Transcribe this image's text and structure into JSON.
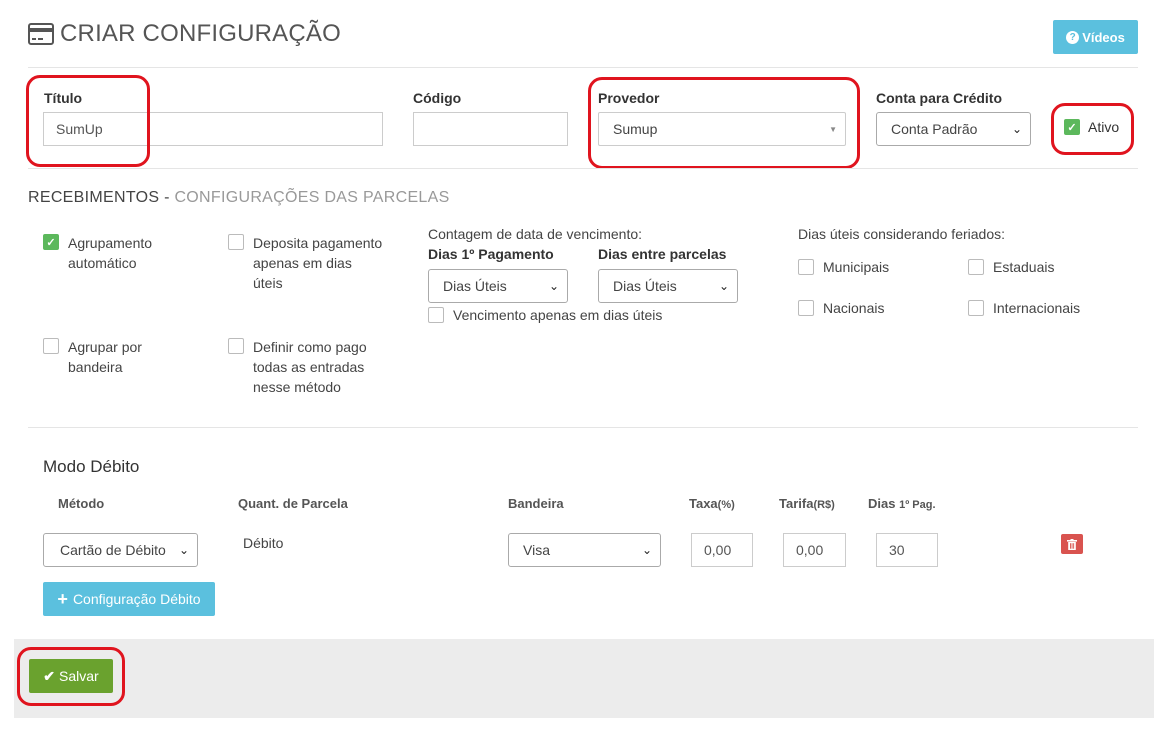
{
  "header": {
    "title": "CRIAR CONFIGURAÇÃO",
    "videos_label": "Vídeos"
  },
  "form": {
    "titulo": {
      "label": "Título",
      "value": "SumUp"
    },
    "codigo": {
      "label": "Código",
      "value": ""
    },
    "provedor": {
      "label": "Provedor",
      "value": "Sumup"
    },
    "conta": {
      "label": "Conta para Crédito",
      "value": "Conta Padrão"
    },
    "ativo": {
      "label": "Ativo",
      "checked": true
    }
  },
  "recebimentos": {
    "title": "RECEBIMENTOS",
    "separator": " - ",
    "subtitle": "CONFIGURAÇÕES DAS PARCELAS",
    "options": {
      "agrupamento": {
        "label_1": "Agrupamento",
        "label_2": "automático",
        "checked": true
      },
      "deposita": {
        "label_1": "Deposita pagamento",
        "label_2": "apenas em dias",
        "label_3": "úteis",
        "checked": false
      },
      "agrupar_bandeira": {
        "label_1": "Agrupar por",
        "label_2": "bandeira",
        "checked": false
      },
      "definir_pago": {
        "label_1": "Definir como pago",
        "label_2": "todas as entradas",
        "label_3": "nesse método",
        "checked": false
      }
    },
    "vencimento": {
      "heading": "Contagem de data de vencimento:",
      "dias_primeiro_label": "Dias 1º Pagamento",
      "dias_primeiro_value": "Dias Úteis",
      "dias_entre_label": "Dias entre parcelas",
      "dias_entre_value": "Dias Úteis",
      "apenas_uteis_label": "Vencimento apenas em dias úteis"
    },
    "feriados": {
      "heading": "Dias úteis considerando feriados:",
      "municipais": "Municipais",
      "estaduais": "Estaduais",
      "nacionais": "Nacionais",
      "internacionais": "Internacionais"
    }
  },
  "debito": {
    "title": "Modo Débito",
    "headers": {
      "metodo": "Método",
      "quant": "Quant. de Parcela",
      "bandeira": "Bandeira",
      "taxa": "Taxa",
      "taxa_unit": "(%)",
      "tarifa": "Tarifa",
      "tarifa_unit": "(R$)",
      "dias": "Dias",
      "dias_unit": "1º Pag."
    },
    "row": {
      "metodo": "Cartão de Débito",
      "quant": "Débito",
      "bandeira": "Visa",
      "taxa": "0,00",
      "tarifa": "0,00",
      "dias": "30"
    },
    "add_label": "Configuração Débito"
  },
  "footer": {
    "save_label": "Salvar"
  },
  "colors": {
    "accent_info": "#5bc0de",
    "success": "#6aa22e",
    "danger": "#d9534f",
    "highlight": "#e0141e"
  }
}
